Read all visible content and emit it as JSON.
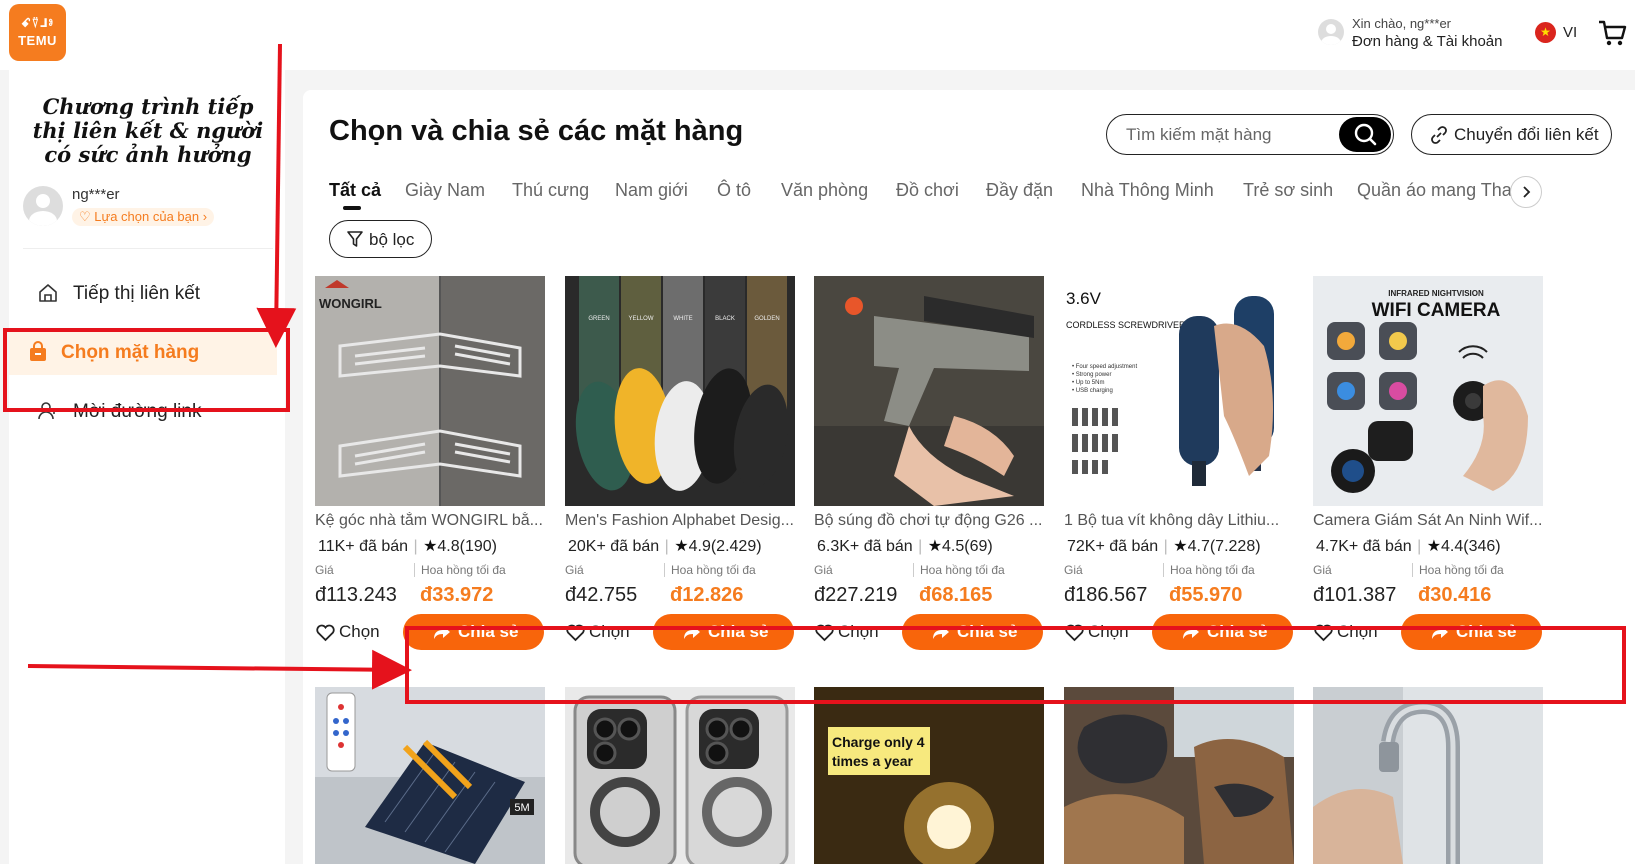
{
  "colors": {
    "accent": "#f57c1f",
    "share_button": "#f8650b",
    "annotation_red": "#e5121c"
  },
  "header": {
    "logo_glyphs": "ꗃ⍢⅃ⱁ",
    "logo_text": "TEMU",
    "greeting": "Xin chào, ng***er",
    "orders_account": "Đơn hàng & Tài khoản",
    "language": "VI",
    "cart_icon": "cart-icon"
  },
  "sidebar": {
    "program_title": "Chương trình tiếp thị liên kết & người có sức ảnh hưởng",
    "username": "ng***er",
    "your_choice": "Lựa chọn của bạn ›",
    "items": [
      {
        "label": "Tiếp thị liên kết",
        "icon": "home-icon",
        "active": false
      },
      {
        "label": "Chọn mặt hàng",
        "icon": "shopping-bag-icon",
        "active": true
      },
      {
        "label": "Mời đường link",
        "icon": "user-plus-icon",
        "active": false
      }
    ]
  },
  "main": {
    "title": "Chọn và chia sẻ các mặt hàng",
    "search_placeholder": "Tìm kiếm mặt hàng",
    "convert_link_label": "Chuyển đổi liên kết",
    "filter_label": "bộ lọc",
    "tabs": [
      "Tất cả",
      "Giày Nam",
      "Thú cưng",
      "Nam giới",
      "Ô tô",
      "Văn phòng",
      "Đồ chơi",
      "Đầy đặn",
      "Nhà Thông Minh",
      "Trẻ sơ sinh",
      "Quần áo mang Thai"
    ],
    "price_label": "Giá",
    "commission_label": "Hoa hồng tối đa",
    "pick_label": "Chọn",
    "share_label": "Chia sẻ",
    "products": [
      {
        "title": "Kệ góc nhà tắm WONGIRL bằ...",
        "sold": "11K+ đã bán",
        "rating": "4.8",
        "reviews": "(190)",
        "price": "đ113.243",
        "commission": "đ33.972"
      },
      {
        "title": "Men's Fashion Alphabet Desig...",
        "sold": "20K+ đã bán",
        "rating": "4.9",
        "reviews": "(2.429)",
        "price": "đ42.755",
        "commission": "đ12.826"
      },
      {
        "title": "Bộ súng đồ chơi tự động G26 ...",
        "sold": "6.3K+ đã bán",
        "rating": "4.5",
        "reviews": "(69)",
        "price": "đ227.219",
        "commission": "đ68.165"
      },
      {
        "title": "1 Bộ tua vít không dây Lithiu...",
        "sold": "72K+ đã bán",
        "rating": "4.7",
        "reviews": "(7.228)",
        "price": "đ186.567",
        "commission": "đ55.970"
      },
      {
        "title": "Camera Giám Sát An Ninh Wif...",
        "sold": "4.7K+ đã bán",
        "rating": "4.4",
        "reviews": "(346)",
        "price": "đ101.387",
        "commission": "đ30.416"
      }
    ],
    "image_texts": {
      "p1_brand": "WONGIRL",
      "p2_colors": [
        "GREEN",
        "YELLOW",
        "WHITE",
        "BLACK",
        "GOLDEN"
      ],
      "p4_voltage": "3.6V",
      "p4_caption": "CORDLESS SCREWDRIVER",
      "p4_bullets": [
        "• Four speed adjustment",
        "• Strong power",
        "• Up to 5Nm",
        "• USB charging"
      ],
      "p5_sub": "INFRARED NIGHTVISION",
      "p5_title": "WIFI CAMERA",
      "t1_len": "5M",
      "t3_caption": "Charge only 4 times a year"
    }
  }
}
